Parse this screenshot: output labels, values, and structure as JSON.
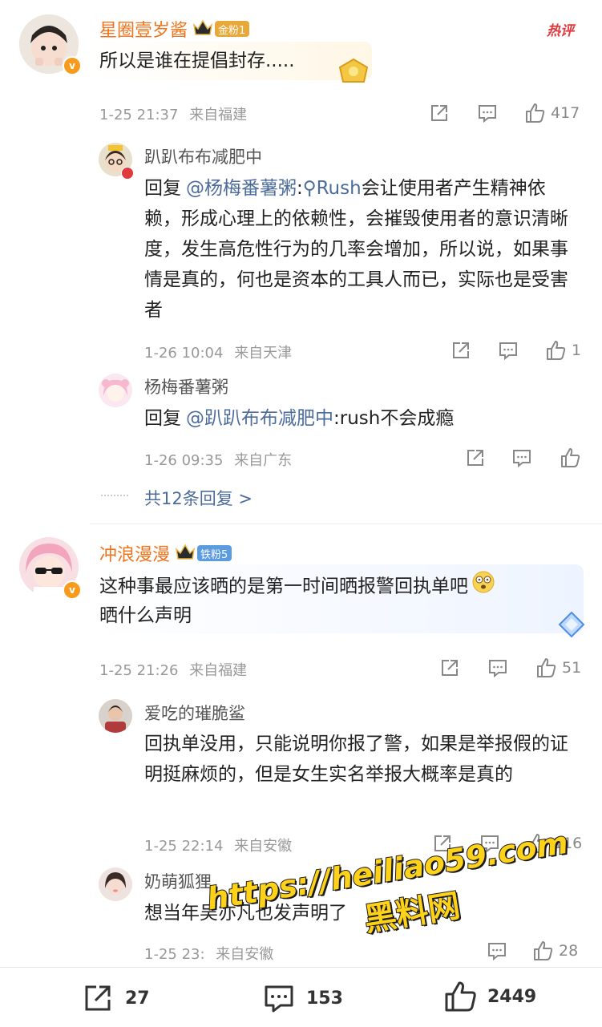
{
  "comments": [
    {
      "username": "星圈壹岁酱",
      "fan_badge": "金粉1",
      "hot_label": "热评",
      "text": "所以是谁在提倡封存.....",
      "time": "1-25 21:37",
      "location": "来自福建",
      "likes": "417",
      "replies": [
        {
          "username": "趴趴布布减肥中",
          "reply_prefix": "回复",
          "mention": "@杨梅番薯粥",
          "colon": ":",
          "search_tag": "Rush",
          "text": "会让使用者产生精神依赖，形成心理上的依赖性，会摧毁使用者的意识清晰度，发生高危性行为的几率会增加，所以说，如果事情是真的，何也是资本的工具人而已，实际也是受害者",
          "time": "1-26 10:04",
          "location": "来自天津",
          "likes": "1"
        },
        {
          "username": "杨梅番薯粥",
          "reply_prefix": "回复",
          "mention": "@趴趴布布减肥中",
          "text": ":rush不会成瘾",
          "time": "1-26 09:35",
          "location": "来自广东",
          "likes": ""
        }
      ],
      "more_replies": "共12条回复 >"
    },
    {
      "username": "冲浪漫漫",
      "fan_badge": "铁粉5",
      "text": "这种事最应该晒的是第一时间晒报警回执单吧",
      "text2": "晒什么声明",
      "time": "1-25 21:26",
      "location": "来自福建",
      "likes": "51",
      "replies": [
        {
          "username": "爱吃的璀脆鲨",
          "text": "回执单没用，只能说明你报了警，如果是举报假的证明挺麻烦的，但是女生实名举报大概率是真的",
          "time": "1-25 22:14",
          "location": "来自安徽",
          "likes": "116"
        },
        {
          "username": "奶萌狐狸",
          "text": "想当年吴亦凡也发声明了",
          "time": "1-25 23:",
          "location": "来自安徽",
          "likes": "28"
        }
      ]
    }
  ],
  "watermark": {
    "line1": "https://heiliao59.com",
    "line2": "黑料网"
  },
  "bottom_bar": {
    "reposts": "27",
    "comments": "153",
    "likes": "2449"
  },
  "colors": {
    "username_orange": "#f1731c",
    "mention_blue": "#4c6c9c",
    "meta_gray": "#999999",
    "badge_gold": "#e8a93a",
    "badge_blue": "#5b9be0",
    "hot_red": "#e0393e"
  },
  "icons": [
    "verified-icon",
    "crown-icon",
    "share-icon",
    "comment-icon",
    "like-icon",
    "search-icon"
  ]
}
